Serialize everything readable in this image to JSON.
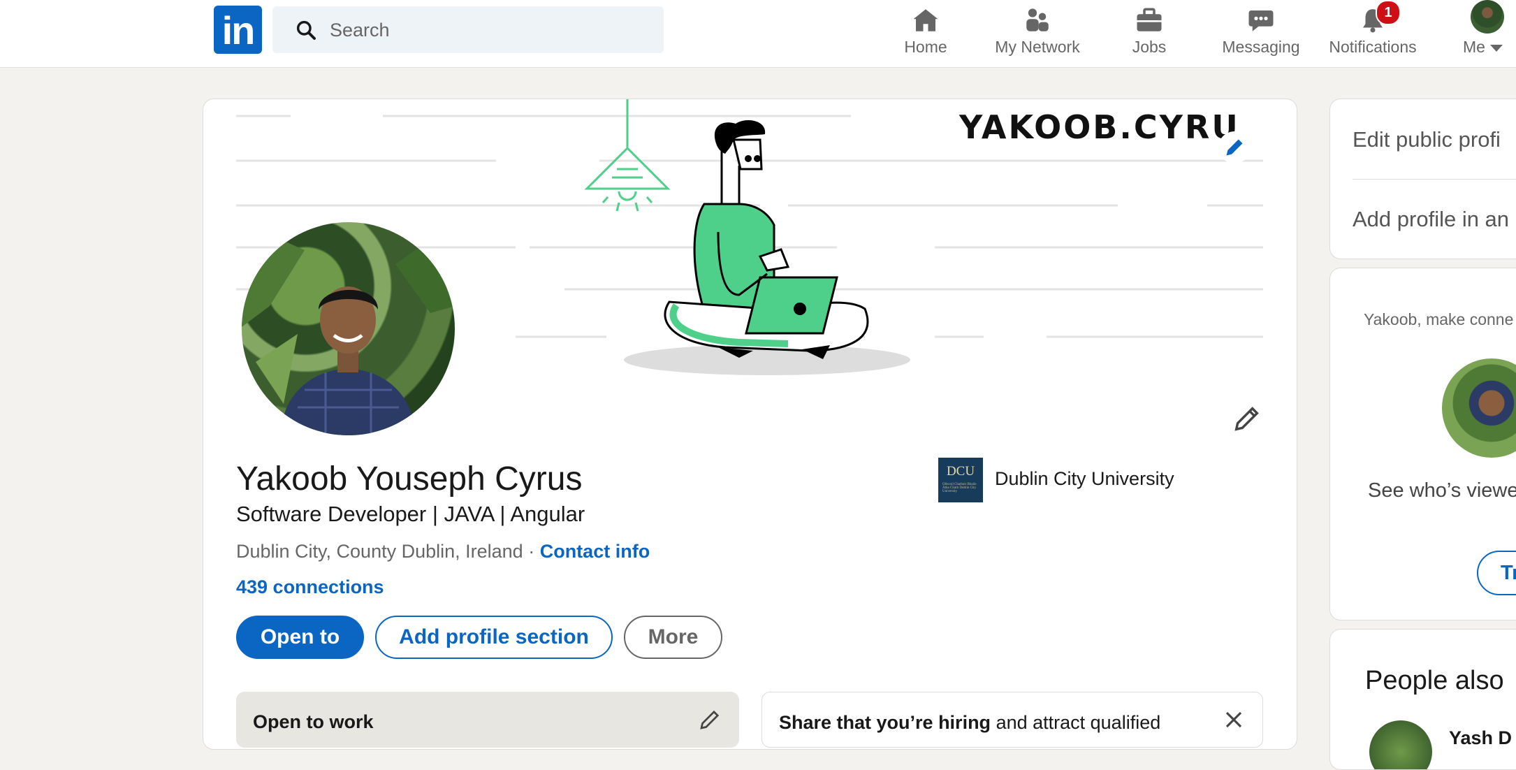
{
  "nav": {
    "logo_text": "in",
    "search_placeholder": "Search",
    "items": [
      {
        "label": "Home",
        "icon": "home-icon"
      },
      {
        "label": "My Network",
        "icon": "people-icon"
      },
      {
        "label": "Jobs",
        "icon": "briefcase-icon"
      },
      {
        "label": "Messaging",
        "icon": "chat-icon"
      },
      {
        "label": "Notifications",
        "icon": "bell-icon",
        "badge": "1"
      },
      {
        "label": "Me",
        "icon": "avatar"
      }
    ]
  },
  "banner": {
    "text": "YAKOOB.CYRU"
  },
  "profile": {
    "name": "Yakoob Youseph Cyrus",
    "headline": "Software Developer | JAVA | Angular",
    "location": "Dublin City, County Dublin, Ireland",
    "separator": " · ",
    "contact_label": "Contact info",
    "connections": "439 connections",
    "education_logo_text": "DCU",
    "education_logo_subtext": "Ollscoil Chathair Bhaile Átha Cliath Dublin City University",
    "education": "Dublin City University"
  },
  "actions": {
    "open_to": "Open to",
    "add_section": "Add profile section",
    "more": "More"
  },
  "subcards": {
    "open_to_work": "Open to work",
    "hiring_bold": "Share that you’re hiring",
    "hiring_rest": " and attract qualified"
  },
  "sidebar": {
    "edit_public": "Edit public profi",
    "add_language": "Add profile in an",
    "make_connections": "Yakoob, make conne",
    "see_viewers": "See who’s viewe",
    "try_button": "Tr",
    "people_also": "People also",
    "person_name": "Yash D"
  },
  "colors": {
    "brand": "#0a66c2",
    "badge": "#cc1016",
    "banner_green": "#4fd08a",
    "background": "#f3f2ef"
  }
}
